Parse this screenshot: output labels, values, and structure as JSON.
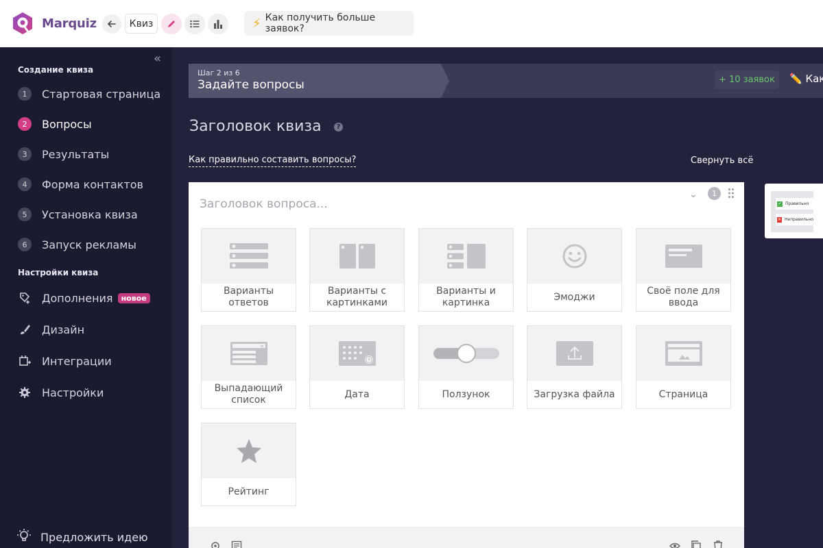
{
  "header": {
    "logo_text": "Marquiz",
    "quiz_button": "Квиз",
    "hint": "Как получить больше заявок?",
    "accent_color": "#d33e86"
  },
  "sidebar": {
    "section_create": "Создание квиза",
    "steps": [
      {
        "num": "1",
        "label": "Стартовая страница"
      },
      {
        "num": "2",
        "label": "Вопросы",
        "active": true
      },
      {
        "num": "3",
        "label": "Результаты"
      },
      {
        "num": "4",
        "label": "Форма контактов"
      },
      {
        "num": "5",
        "label": "Установка квиза"
      },
      {
        "num": "6",
        "label": "Запуск рекламы"
      }
    ],
    "section_settings": "Настройки квиза",
    "settings": [
      {
        "label": "Дополнения",
        "icon": "addons-icon",
        "badge": "новое"
      },
      {
        "label": "Дизайн",
        "icon": "brush-icon"
      },
      {
        "label": "Интеграции",
        "icon": "integrations-icon"
      },
      {
        "label": "Настройки",
        "icon": "gear-icon"
      }
    ],
    "idea": "Предложить идею"
  },
  "stepbar": {
    "step_counter": "Шаг 2 из 6",
    "step_title": "Задайте вопросы",
    "leads": "+ 10 заявок",
    "edit_label": "Как"
  },
  "main": {
    "quiz_title": "Заголовок квиза",
    "help": "?",
    "how_link": "Как правильно составить вопросы?",
    "collapse_all": "Свернуть всё"
  },
  "question_card": {
    "placeholder": "Заголовок вопроса...",
    "number": "1",
    "types": [
      {
        "label": "Варианты ответов",
        "icon": "answer-options-icon"
      },
      {
        "label": "Варианты с картинками",
        "icon": "image-options-icon"
      },
      {
        "label": "Варианты и картинка",
        "icon": "options-and-image-icon"
      },
      {
        "label": "Эмоджи",
        "icon": "emoji-icon"
      },
      {
        "label": "Своё поле для ввода",
        "icon": "text-field-icon"
      },
      {
        "label": "Выпадающий список",
        "icon": "dropdown-icon"
      },
      {
        "label": "Дата",
        "icon": "calendar-icon"
      },
      {
        "label": "Ползунок",
        "icon": "slider-icon"
      },
      {
        "label": "Загрузка файла",
        "icon": "upload-icon"
      },
      {
        "label": "Страница",
        "icon": "page-icon"
      },
      {
        "label": "Рейтинг",
        "icon": "star-icon"
      }
    ]
  },
  "preview": {
    "correct": "Правильно",
    "incorrect": "Неправильно"
  }
}
